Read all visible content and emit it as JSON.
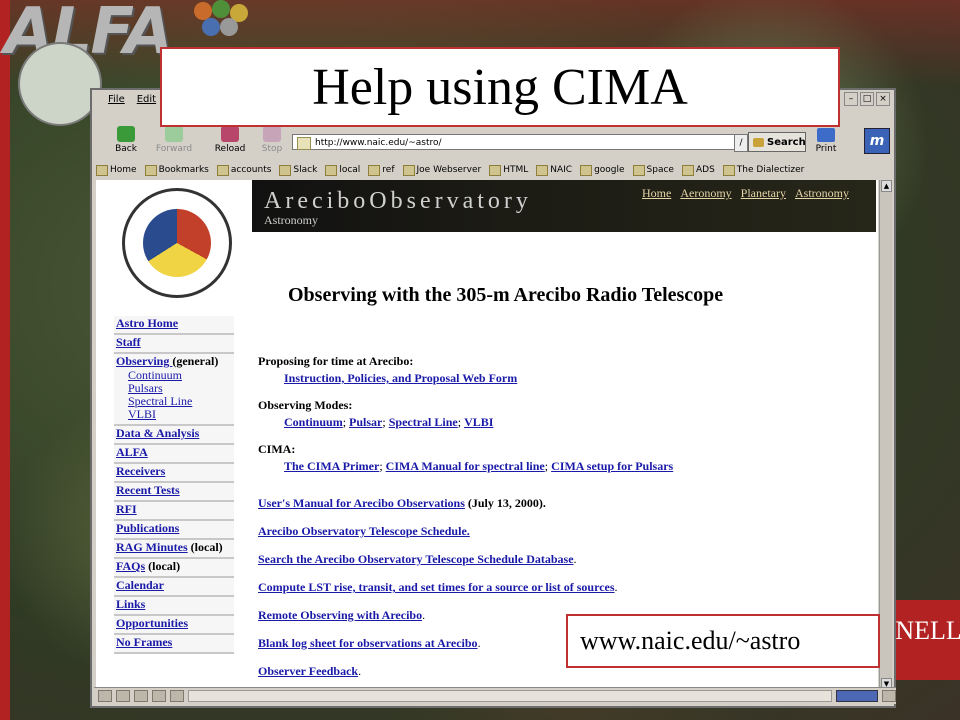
{
  "slide": {
    "logo_text": "ALFA",
    "title": "Help using CIMA",
    "callout": "www.naic.edu/~astro",
    "cornell_text": "RNELL",
    "accent_color": "#c03030"
  },
  "browser": {
    "menu": [
      "File",
      "Edit"
    ],
    "toolbar": {
      "back": "Back",
      "forward": "Forward",
      "reload": "Reload",
      "stop": "Stop",
      "search": "Search",
      "print": "Print"
    },
    "url": "http://www.naic.edu/~astro/",
    "bookmarks": [
      "Home",
      "Bookmarks",
      "accounts",
      "Slack",
      "local",
      "ref",
      "Joe Webserver",
      "HTML",
      "NAIC",
      "google",
      "Space",
      "ADS",
      "The Dialectizer"
    ]
  },
  "page": {
    "banner": {
      "brand": "AreciboObservatory",
      "subtitle": "Astronomy",
      "nav": [
        "Home",
        "Aeronomy",
        "Planetary",
        "Astronomy"
      ]
    },
    "heading": "Observing with the 305-m Arecibo Radio Telescope",
    "leftnav": {
      "astro_home": "Astro Home",
      "staff": "Staff",
      "observing": "Observing ",
      "observing_general": "(general)",
      "observing_sub": [
        "Continuum",
        "Pulsars",
        "Spectral Line",
        "VLBI"
      ],
      "data_analysis": "Data & Analysis",
      "alfa": "ALFA",
      "receivers": "Receivers",
      "recent_tests": "Recent Tests",
      "rfi": "RFI",
      "publications": "Publications",
      "rag_minutes": "RAG Minutes",
      "rag_local": " (local)",
      "faqs": "FAQs",
      "faqs_local": " (local)",
      "calendar": "Calendar",
      "links": "Links",
      "opportunities": "Opportunities",
      "no_frames": "No Frames"
    },
    "content": {
      "proposing_title": "Proposing for time at Arecibo:",
      "proposing_link": "Instruction, Policies, and Proposal Web Form",
      "modes_title": "Observing Modes:",
      "modes": [
        "Continuum",
        "Pulsar",
        "Spectral Line",
        "VLBI"
      ],
      "cima_title": "CIMA:",
      "cima_links": [
        "The CIMA Primer",
        "CIMA Manual for spectral line",
        "CIMA setup for Pulsars"
      ],
      "users_manual": "User's Manual for Arecibo Observations",
      "users_manual_date": " (July 13, 2000).",
      "schedule": "Arecibo Observatory Telescope Schedule.",
      "schedule_db": "Search the Arecibo Observatory Telescope Schedule Database",
      "lst": "Compute LST rise, transit, and set times for a source or list of sources",
      "remote": "Remote Observing with Arecibo",
      "logsheet": "Blank log sheet for observations at Arecibo",
      "feedback": "Observer Feedback"
    }
  }
}
